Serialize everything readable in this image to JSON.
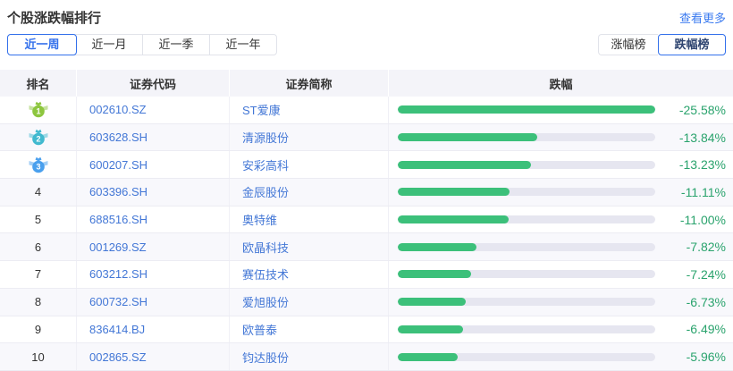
{
  "header": {
    "title": "个股涨跌幅排行",
    "more_link": "查看更多"
  },
  "period_tabs": [
    {
      "label": "近一周",
      "active": true
    },
    {
      "label": "近一月",
      "active": false
    },
    {
      "label": "近一季",
      "active": false
    },
    {
      "label": "近一年",
      "active": false
    }
  ],
  "board_tabs": [
    {
      "label": "涨幅榜",
      "active": false
    },
    {
      "label": "跌幅榜",
      "active": true
    }
  ],
  "table": {
    "columns": [
      "排名",
      "证券代码",
      "证券简称",
      "跌幅"
    ],
    "max_abs_change": 25.58,
    "rows": [
      {
        "rank": 1,
        "code": "002610.SZ",
        "name": "ST爱康",
        "change_label": "-25.58%",
        "change_abs": 25.58
      },
      {
        "rank": 2,
        "code": "603628.SH",
        "name": "清源股份",
        "change_label": "-13.84%",
        "change_abs": 13.84
      },
      {
        "rank": 3,
        "code": "600207.SH",
        "name": "安彩高科",
        "change_label": "-13.23%",
        "change_abs": 13.23
      },
      {
        "rank": 4,
        "code": "603396.SH",
        "name": "金辰股份",
        "change_label": "-11.11%",
        "change_abs": 11.11
      },
      {
        "rank": 5,
        "code": "688516.SH",
        "name": "奥特维",
        "change_label": "-11.00%",
        "change_abs": 11.0
      },
      {
        "rank": 6,
        "code": "001269.SZ",
        "name": "欧晶科技",
        "change_label": "-7.82%",
        "change_abs": 7.82
      },
      {
        "rank": 7,
        "code": "603212.SH",
        "name": "赛伍技术",
        "change_label": "-7.24%",
        "change_abs": 7.24
      },
      {
        "rank": 8,
        "code": "600732.SH",
        "name": "爱旭股份",
        "change_label": "-6.73%",
        "change_abs": 6.73
      },
      {
        "rank": 9,
        "code": "836414.BJ",
        "name": "欧普泰",
        "change_label": "-6.49%",
        "change_abs": 6.49
      },
      {
        "rank": 10,
        "code": "002865.SZ",
        "name": "钧达股份",
        "change_label": "-5.96%",
        "change_abs": 5.96
      }
    ]
  },
  "medals": {
    "icon_names": [
      "gold-medal-icon",
      "silver-medal-icon",
      "bronze-medal-icon"
    ],
    "colors": [
      "#8dc63f",
      "#41b9cf",
      "#4aa0ee"
    ]
  },
  "colors": {
    "accent_blue": "#3370eb",
    "link_blue": "#3b7bf0",
    "code_blue": "#4377d6",
    "bar_green": "#3cc07a",
    "pct_green": "#2aa36d",
    "bar_track": "#e6e6f0",
    "header_bg": "#f4f4f9",
    "row_alt_bg": "#f8f8fc",
    "divider": "#ececf3",
    "text_dark": "#333333"
  }
}
